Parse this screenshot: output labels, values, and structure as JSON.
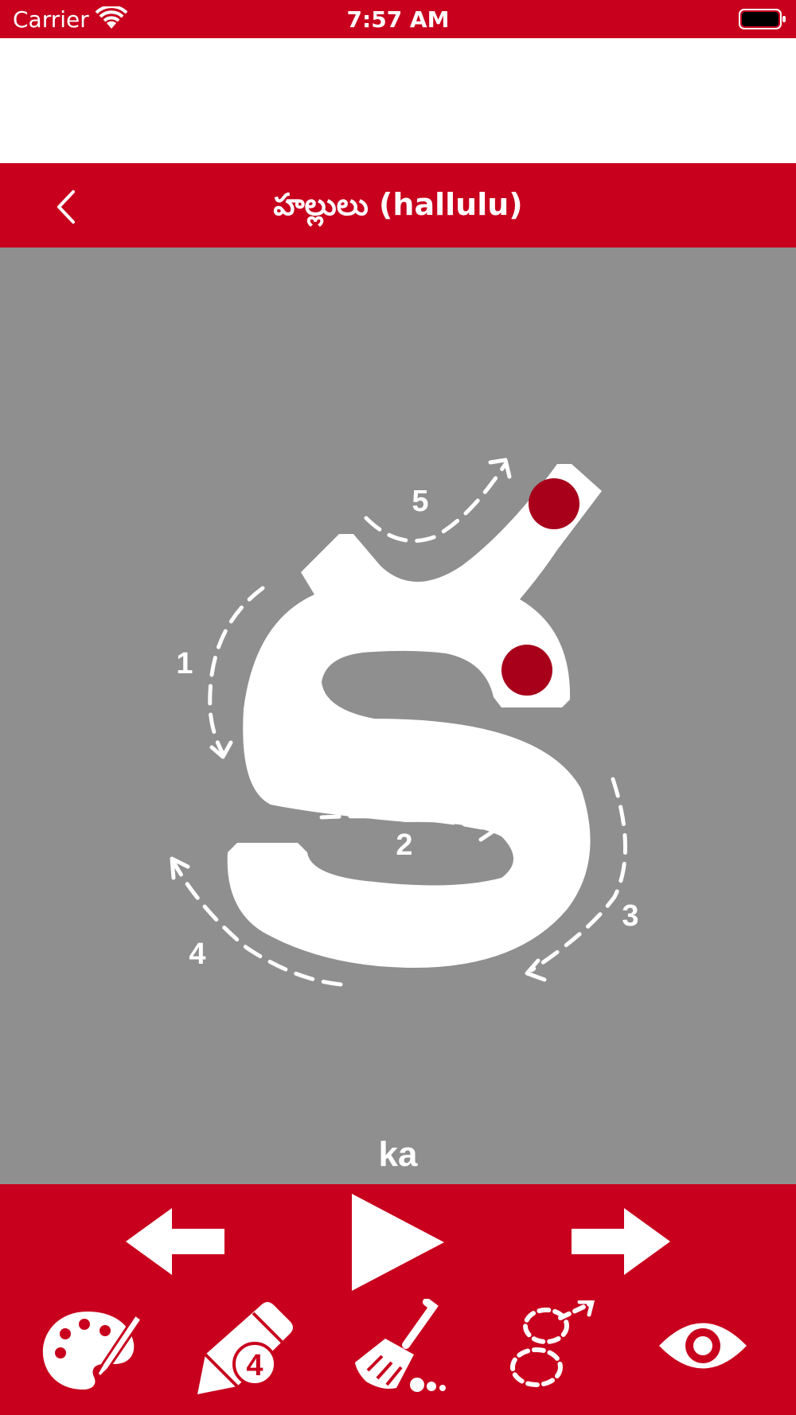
{
  "status_bar": {
    "carrier": "Carrier",
    "time": "7:57 AM",
    "wifi_icon": "wifi-icon",
    "battery_icon": "battery-full-icon"
  },
  "nav": {
    "title": "హల్లులు (hallulu)",
    "back_icon": "chevron-left-icon"
  },
  "letter": {
    "glyph": "క",
    "transliteration": "ka",
    "stroke_numbers": [
      "1",
      "2",
      "3",
      "4",
      "5"
    ]
  },
  "toolbar": {
    "prev_icon": "arrow-left-icon",
    "play_icon": "play-icon",
    "next_icon": "arrow-right-icon",
    "tools": [
      {
        "icon": "palette-icon"
      },
      {
        "icon": "pencil-icon",
        "badge": "4"
      },
      {
        "icon": "broom-icon"
      },
      {
        "icon": "trace-path-icon"
      },
      {
        "icon": "eye-icon"
      }
    ]
  },
  "colors": {
    "brand_red": "#c8001d",
    "canvas_gray": "#8f8f8f",
    "dot_red": "#a8001a"
  }
}
